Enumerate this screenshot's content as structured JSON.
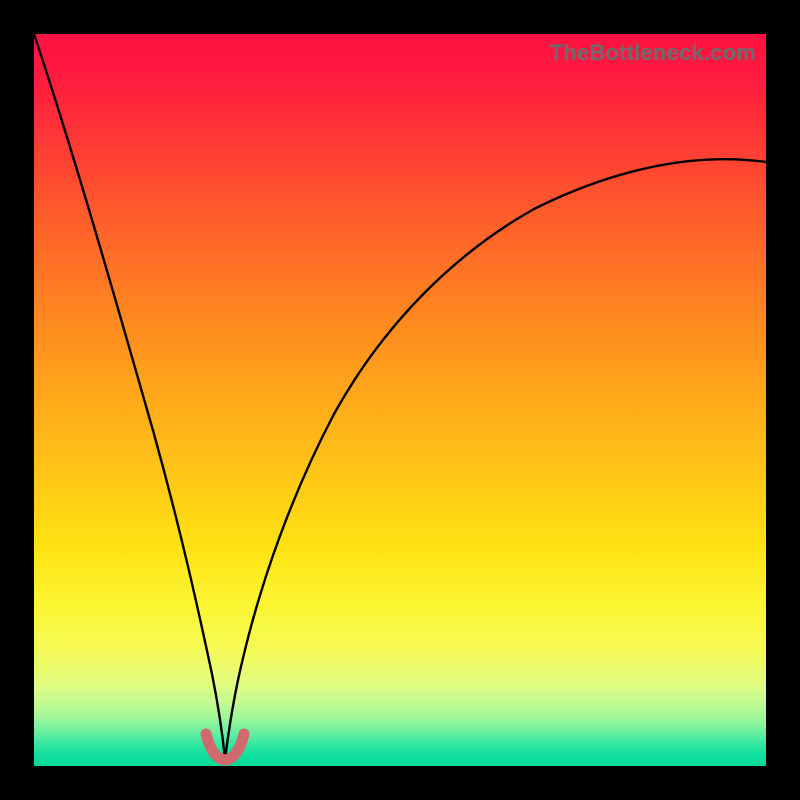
{
  "watermark": "TheBottleneck.com",
  "colors": {
    "background": "#000000",
    "curve_stroke": "#000000",
    "marker_stroke": "#d16a6e",
    "gradient_top": "#ff1141",
    "gradient_bottom": "#04d997"
  },
  "chart_data": {
    "type": "line",
    "title": "",
    "xlabel": "",
    "ylabel": "",
    "xlim": [
      0,
      100
    ],
    "ylim": [
      0,
      100
    ],
    "grid": false,
    "legend": false,
    "series": [
      {
        "name": "curve-left",
        "x": [
          0,
          3,
          6,
          9,
          12,
          15,
          18,
          20,
          22,
          23.5,
          25,
          26
        ],
        "y": [
          100,
          87,
          74,
          61,
          48,
          35,
          22,
          14,
          8,
          4,
          1.5,
          0.5
        ]
      },
      {
        "name": "curve-right",
        "x": [
          26,
          27,
          28.5,
          30,
          32,
          35,
          40,
          46,
          54,
          64,
          76,
          88,
          100
        ],
        "y": [
          0.5,
          2,
          6,
          12,
          20,
          30,
          42,
          52,
          60,
          67,
          73,
          78.5,
          82
        ]
      },
      {
        "name": "valley-marker",
        "x": [
          23.4,
          24,
          25,
          26,
          27,
          28,
          28.6
        ],
        "y": [
          4.2,
          2.2,
          1.0,
          0.6,
          1.0,
          2.2,
          4.2
        ]
      }
    ],
    "note": "Axis values are relative percentages estimated from the unlabeled gradient plot; the curve descends from top-left, reaches its minimum near x≈26%, then rises asymptotically toward ~82% at the right edge. The pink valley-marker is a short thick U-shaped highlight at the minimum."
  }
}
